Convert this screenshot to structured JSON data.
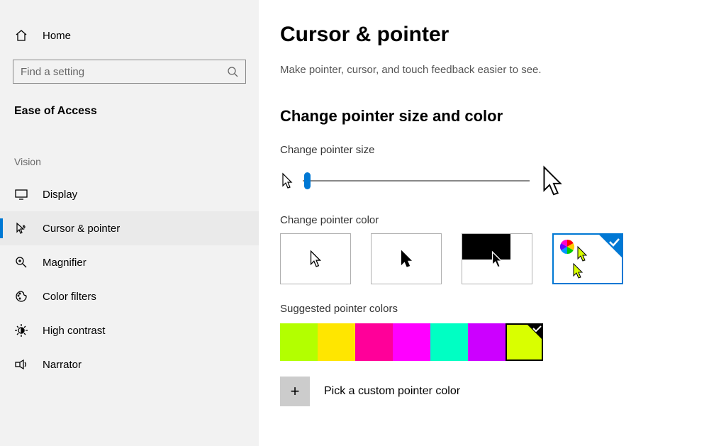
{
  "sidebar": {
    "home": "Home",
    "search_placeholder": "Find a setting",
    "category": "Ease of Access",
    "group": "Vision",
    "items": [
      {
        "label": "Display"
      },
      {
        "label": "Cursor & pointer"
      },
      {
        "label": "Magnifier"
      },
      {
        "label": "Color filters"
      },
      {
        "label": "High contrast"
      },
      {
        "label": "Narrator"
      }
    ]
  },
  "page": {
    "title": "Cursor & pointer",
    "description": "Make pointer, cursor, and touch feedback easier to see.",
    "section1": "Change pointer size and color",
    "size_label": "Change pointer size",
    "color_label": "Change pointer color",
    "suggested_label": "Suggested pointer colors",
    "custom_label": "Pick a custom pointer color"
  },
  "colors": {
    "suggested": [
      "#b3ff00",
      "#ffe600",
      "#ff0099",
      "#ff00ff",
      "#00ffc3",
      "#cc00ff",
      "#d9ff00"
    ],
    "selected_index": 6
  }
}
